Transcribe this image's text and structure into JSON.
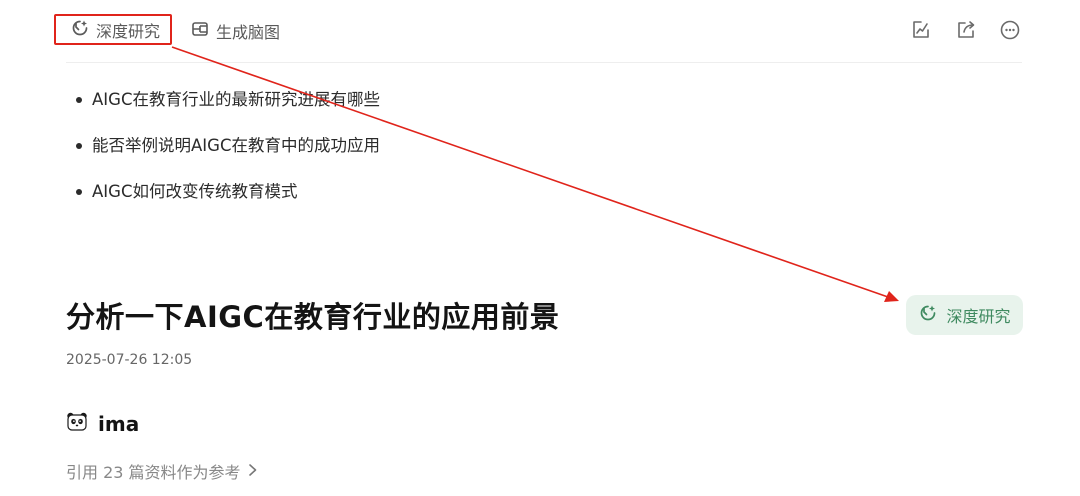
{
  "toolbar": {
    "deep_research_label": "深度研究",
    "mind_map_label": "生成脑图",
    "icons": [
      "edit-icon",
      "share-icon",
      "more-icon"
    ]
  },
  "bullets": [
    "AIGC在教育行业的最新研究进展有哪些",
    "能否举例说明AIGC在教育中的成功应用",
    "AIGC如何改变传统教育模式"
  ],
  "query": {
    "title": "分析一下AIGC在教育行业的应用前景",
    "timestamp": "2025-07-26 12:05",
    "deep_research_label": "深度研究"
  },
  "answer": {
    "author": "ima",
    "references": "引用 23 篇资料作为参考"
  },
  "colors": {
    "annotation_red": "#e0241b",
    "pill_bg": "#e8f3ec",
    "pill_text": "#3f8a60"
  }
}
